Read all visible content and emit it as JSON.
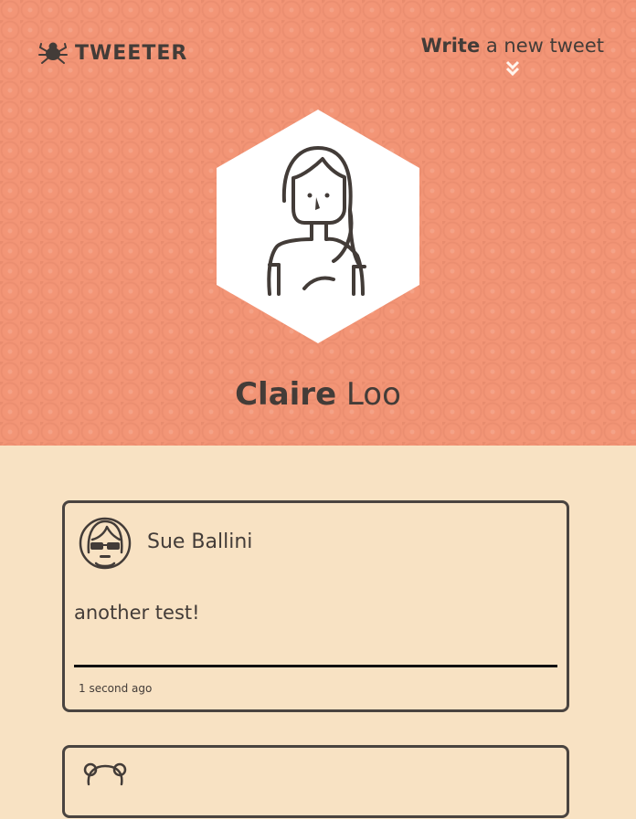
{
  "app": {
    "brand": "TWEETER"
  },
  "header": {
    "compose_bold": "Write",
    "compose_rest": " a new tweet"
  },
  "profile": {
    "first_name": "Claire",
    "last_name": " Loo"
  },
  "tweets": [
    {
      "author": "Sue Ballini",
      "text": "another test!",
      "time": "1 second ago"
    }
  ],
  "colors": {
    "hero_bg": "#f39576",
    "page_bg": "#f8e2c3",
    "ink": "#4a4440"
  },
  "icons": {
    "logo": "bug-icon",
    "compose": "double-chevron-down-icon"
  }
}
